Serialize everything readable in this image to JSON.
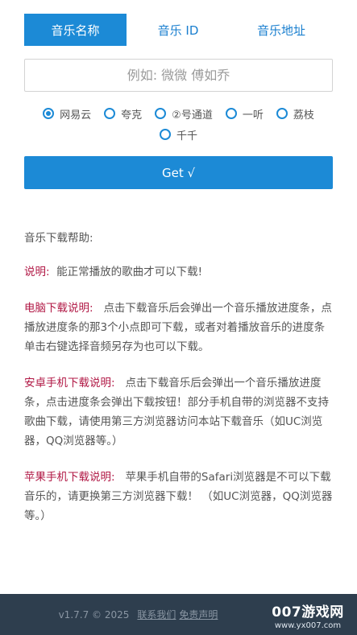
{
  "tabs": [
    {
      "label": "音乐名称",
      "active": true
    },
    {
      "label": "音乐 ID",
      "active": false
    },
    {
      "label": "音乐地址",
      "active": false
    }
  ],
  "search": {
    "placeholder": "例如: 微微 傅如乔",
    "value": ""
  },
  "sources": [
    {
      "label": "网易云",
      "checked": true
    },
    {
      "label": "夸克",
      "checked": false
    },
    {
      "label": "②号通道",
      "checked": false
    },
    {
      "label": "一听",
      "checked": false
    },
    {
      "label": "荔枝",
      "checked": false
    },
    {
      "label": "千千",
      "checked": false
    }
  ],
  "get_button": {
    "label": "Get √"
  },
  "help": {
    "title": "音乐下载帮助:",
    "items": [
      {
        "heading": "说明:",
        "text": "能正常播放的歌曲才可以下载!"
      },
      {
        "heading": "电脑下载说明:",
        "text": "点击下载音乐后会弹出一个音乐播放进度条，点播放进度条的那3个小点即可下载，或者对着播放音乐的进度条单击右键选择音频另存为也可以下载。"
      },
      {
        "heading": "安卓手机下载说明:",
        "text": "点击下载音乐后会弹出一个音乐播放进度条，点击进度条会弹出下载按钮！部分手机自带的浏览器不支持歌曲下载，请使用第三方浏览器访问本站下载音乐（如UC浏览器，QQ浏览器等。）"
      },
      {
        "heading": "苹果手机下载说明:",
        "text": "苹果手机自带的Safari浏览器是不可以下载音乐的，请更换第三方浏览器下载！ （如UC浏览器，QQ浏览器等。）"
      }
    ]
  },
  "footer": {
    "version": "v1.7.7 © 2025",
    "contact": "联系我们",
    "disclaimer": "免责声明"
  },
  "watermark": {
    "line1": "007游戏网",
    "line2": "www.yx007.com"
  },
  "colors": {
    "accent": "#1c8ad6",
    "highlight": "#b11845",
    "footer_bg": "#2e3e4e"
  }
}
